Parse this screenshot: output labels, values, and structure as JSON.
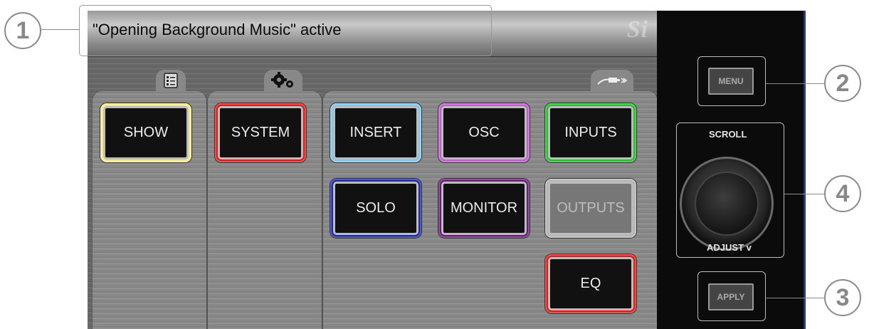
{
  "status": {
    "message": "\"Opening Background Music\" active",
    "brand": "Si"
  },
  "tabs": {
    "show_icon": "list-icon",
    "system_icon": "gears-icon",
    "main_icon": "cable-icon"
  },
  "tiles": [
    {
      "label": "SHOW",
      "color": "#f5ea8a",
      "enabled": true
    },
    {
      "label": "SYSTEM",
      "color": "#e01a1a",
      "enabled": true
    },
    {
      "label": "INSERT",
      "color": "#7fc6ef",
      "enabled": true
    },
    {
      "label": "OSC",
      "color": "#c25ad0",
      "enabled": true
    },
    {
      "label": "INPUTS",
      "color": "#22c12a",
      "enabled": true
    },
    {
      "label": "SOLO",
      "color": "#1a2aa8",
      "enabled": true
    },
    {
      "label": "MONITOR",
      "color": "#6a1a78",
      "enabled": true
    },
    {
      "label": "OUTPUTS",
      "color": "#b5b5b5",
      "enabled": false
    },
    {
      "label": "EQ",
      "color": "#e01a1a",
      "enabled": true
    }
  ],
  "hardware": {
    "menu_label": "MENU",
    "apply_label": "APPLY",
    "scroll_label": "SCROLL",
    "adjust_label": "ADJUST v"
  },
  "callouts": [
    "1",
    "2",
    "3",
    "4"
  ],
  "colors": {
    "side_border": "#1f3c8c",
    "callout": "#8a8a8a"
  }
}
